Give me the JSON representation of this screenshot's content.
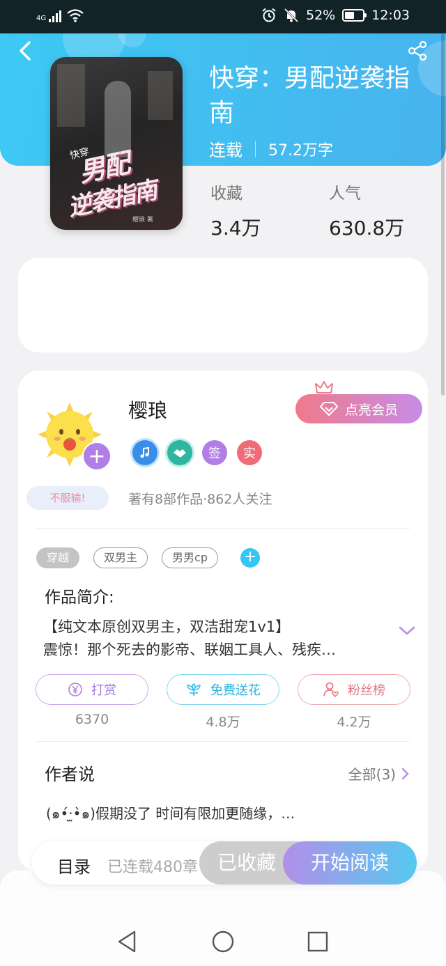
{
  "status_bar": {
    "network": "4G",
    "battery": "52%",
    "battery_level": 0.52,
    "time": "12:03"
  },
  "header": {
    "back_icon": "chevron-left-icon",
    "share_icon": "share-icon",
    "gradient_colors": [
      "#3dc9f3",
      "#47b3ee"
    ]
  },
  "book": {
    "cover": {
      "small_text": "快穿",
      "title_line1": "男配",
      "title_line2": "逆袭指南",
      "author_small": "樱琅 著"
    },
    "title": "快穿：男配逆袭指南",
    "status": "连载",
    "word_count": "57.2万字",
    "stats": [
      {
        "label": "收藏",
        "value": "3.4万"
      },
      {
        "label": "人气",
        "value": "630.8万"
      }
    ]
  },
  "author": {
    "name": "樱琅",
    "follow_icon": "plus-icon",
    "badges": [
      {
        "icon": "music-medal-icon",
        "text": "",
        "color": "#3a8ee8"
      },
      {
        "icon": "handshake-medal-icon",
        "text": "",
        "color": "#30b5a0"
      },
      {
        "icon": "signed-badge-icon",
        "text": "签",
        "color": "#b07ee6"
      },
      {
        "icon": "verified-badge-icon",
        "text": "实",
        "color": "#ef6b78"
      }
    ],
    "vip_button": "点亮会员",
    "bubble_text": "不服输!",
    "stats_text": "著有8部作品·862人关注"
  },
  "tags": [
    {
      "label": "穿越",
      "filled": true
    },
    {
      "label": "双男主",
      "filled": false
    },
    {
      "label": "男男cp",
      "filled": false
    }
  ],
  "intro": {
    "title": "作品简介:",
    "line1": "【纯文本原创双男主，双洁甜宠1v1】",
    "line2": "震惊！那个死去的影帝、联姻工具人、残疾…"
  },
  "actions": [
    {
      "label": "打赏",
      "count": "6370",
      "icon": "yen-coin-icon",
      "color": "#b58be0"
    },
    {
      "label": "免费送花",
      "count": "4.8万",
      "icon": "flower-icon",
      "color": "#34c2e8"
    },
    {
      "label": "粉丝榜",
      "count": "4.2万",
      "icon": "person-heart-icon",
      "color": "#e87c84"
    }
  ],
  "author_says": {
    "title": "作者说",
    "all_label": "全部(3)",
    "preview": "(๑•́‧̫•̀๑)假期没了 时间有限加更随缘，…"
  },
  "bottom_bar": {
    "toc_label": "目录",
    "toc_status": "已连载480章",
    "collected_label": "已收藏",
    "read_label": "开始阅读"
  },
  "nav": {
    "back_icon": "nav-back-icon",
    "home_icon": "nav-home-icon",
    "recents_icon": "nav-recents-icon"
  }
}
